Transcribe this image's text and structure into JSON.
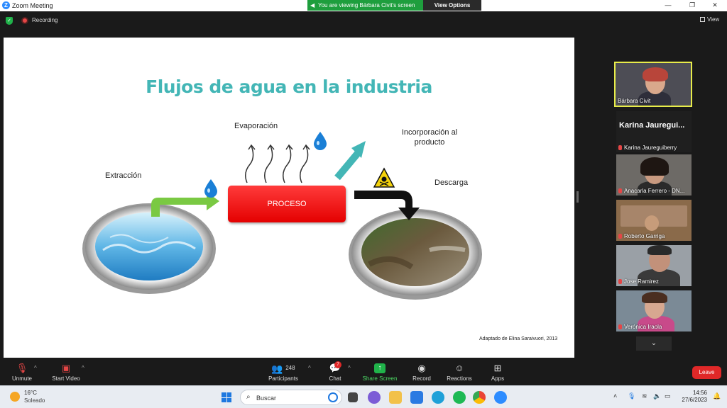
{
  "window": {
    "title": "Zoom Meeting",
    "banner": "You are viewing Bárbara Civit's screen",
    "view_options": "View Options",
    "minimize": "—",
    "maximize": "❐",
    "close": "✕"
  },
  "top": {
    "recording": "Recording",
    "view": "View"
  },
  "slide": {
    "title": "Flujos de agua en la industria",
    "extraccion": "Extracción",
    "evaporacion": "Evaporación",
    "incorporacion_1": "Incorporación al",
    "incorporacion_2": "producto",
    "descarga": "Descarga",
    "proceso": "PROCESO",
    "credit": "Adaptado de Elina Saraivuori, 2013"
  },
  "participants": [
    {
      "name": "Bárbara Civit"
    },
    {
      "name": "Karina Jauregui...",
      "subname": "Karina Jaureguiberry"
    },
    {
      "name": "Anacarla Ferrero - DN..."
    },
    {
      "name": "Roberto Garriga"
    },
    {
      "name": "Jose Ramirez"
    },
    {
      "name": "Verónica Iraola"
    }
  ],
  "toolbar": {
    "unmute": "Unmute",
    "start_video": "Start Video",
    "participants": "Participants",
    "participants_count": "248",
    "chat": "Chat",
    "chat_badge": "7",
    "share_screen": "Share Screen",
    "record": "Record",
    "reactions": "Reactions",
    "apps": "Apps",
    "leave": "Leave"
  },
  "taskbar": {
    "temp": "16°C",
    "condition": "Soleado",
    "search": "Buscar",
    "time": "14:56",
    "date": "27/6/2023"
  },
  "colors": {
    "title_teal": "#43b6b6",
    "proceso_red": "#e40000",
    "banner_green": "#1e9e3d",
    "leave_red": "#e02828",
    "active_speaker": "#e8ec4a"
  }
}
